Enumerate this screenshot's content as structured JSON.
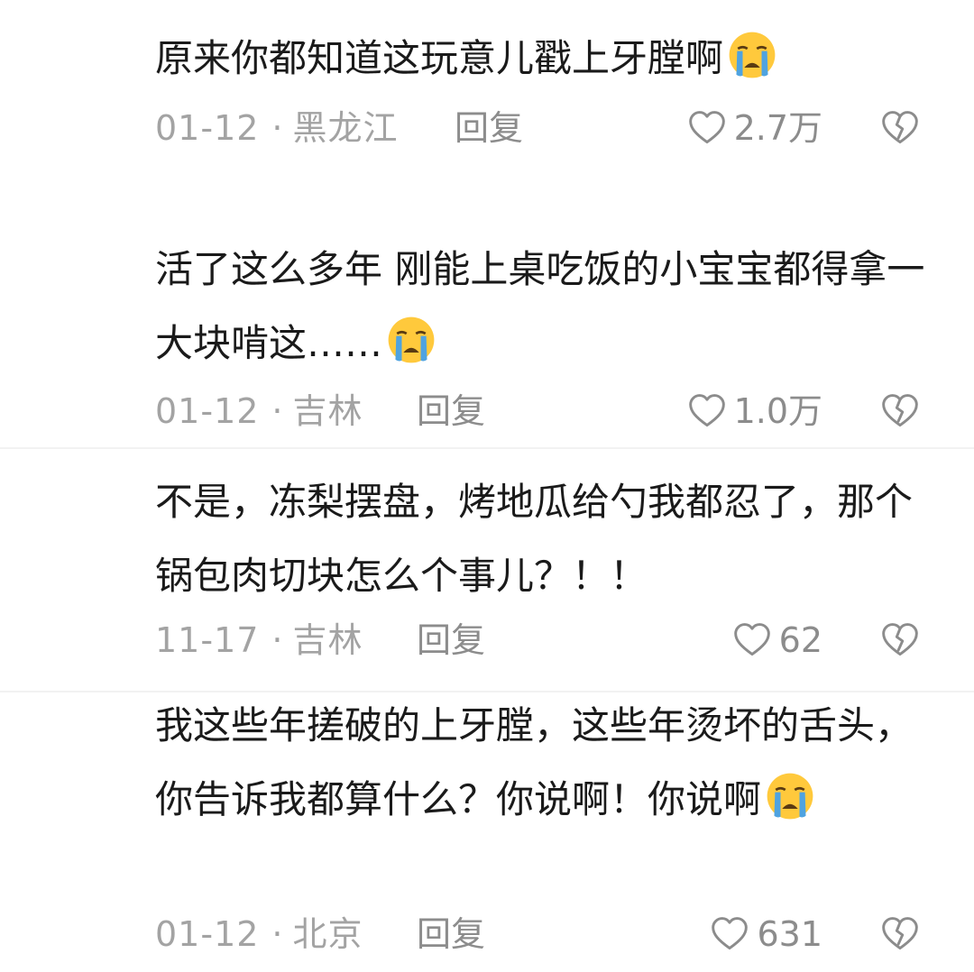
{
  "comments": [
    {
      "text": "原来你都知道这玩意儿戳上牙膛啊",
      "emoji": "loudly-crying-face-emoji",
      "date": "01-12",
      "separator": "·",
      "location": "黑龙江",
      "reply_label": "回复",
      "likes": "2.7万"
    },
    {
      "text": "活了这么多年 刚能上桌吃饭的小宝宝都得拿一大块啃这……",
      "emoji": "loudly-crying-face-emoji",
      "date": "01-12",
      "separator": "·",
      "location": "吉林",
      "reply_label": "回复",
      "likes": "1.0万"
    },
    {
      "text": "不是，冻梨摆盘，烤地瓜给勺我都忍了，那个锅包肉切块怎么个事儿？！！",
      "emoji": "",
      "date": "11-17",
      "separator": "·",
      "location": "吉林",
      "reply_label": "回复",
      "likes": "62"
    },
    {
      "text": "我这些年搓破的上牙膛，这些年烫坏的舌头，你告诉我都算什么？你说啊！你说啊",
      "emoji": "loudly-crying-face-emoji",
      "date": "01-12",
      "separator": "·",
      "location": "北京",
      "reply_label": "回复",
      "likes": "631"
    }
  ],
  "colors": {
    "text": "#1a1a1a",
    "meta": "#a3a3a3",
    "action": "#8c8c8c",
    "emoji_face": "#FFC93C",
    "emoji_tear": "#4FA3E0"
  },
  "icons": {
    "like": "heart-outline-icon",
    "dislike": "broken-heart-outline-icon"
  }
}
